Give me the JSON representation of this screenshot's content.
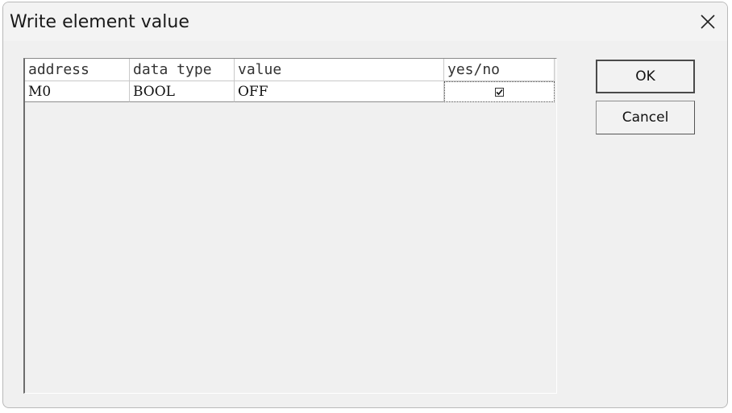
{
  "dialog": {
    "title": "Write element value",
    "close_icon": "close-icon"
  },
  "table": {
    "columns": [
      "address",
      "data type",
      "value",
      "yes/no"
    ],
    "rows": [
      {
        "address": "M0",
        "data_type": "BOOL",
        "value": "OFF",
        "yes_no_checked": true
      }
    ]
  },
  "buttons": {
    "ok_label": "OK",
    "cancel_label": "Cancel"
  }
}
